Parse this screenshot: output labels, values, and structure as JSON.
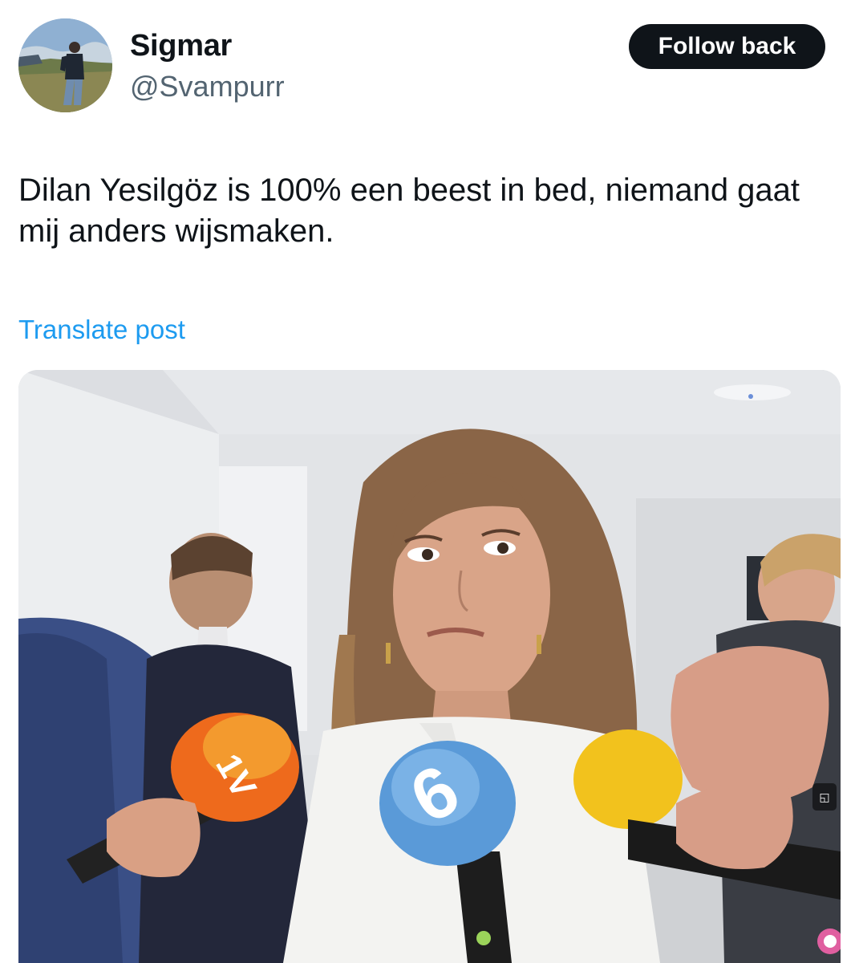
{
  "post": {
    "author": {
      "name": "Sigmar",
      "handle": "@Svampurr"
    },
    "follow_label": "Follow back",
    "text": "Dilan Yesilgöz is 100% een beest in bed, niemand gaat mij anders wijsmaken.",
    "translate_label": "Translate post"
  },
  "media": {
    "mic_orange_logo": "1V",
    "mic_blue_logo": "6"
  },
  "colors": {
    "button_bg": "#0f1419",
    "link": "#1d9bf0",
    "handle": "#536471"
  },
  "icons": {
    "media_badge": "alt-badge-icon"
  }
}
